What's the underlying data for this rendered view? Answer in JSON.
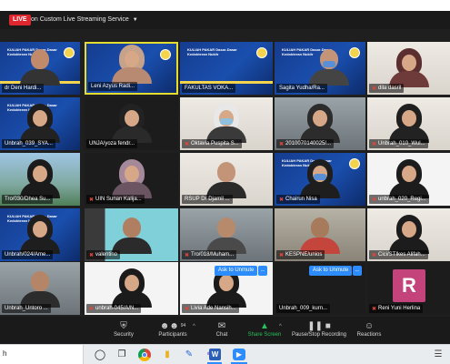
{
  "topbar": {
    "live_label": "LIVE",
    "stream_label": "on Custom Live Streaming Service"
  },
  "slide": {
    "title": "KULIAH PAKAR Dasar-Dasar Kedokteran Nuklir",
    "date": "Sabtu, 27 Maret 2021"
  },
  "participants": [
    {
      "name": "dr Deni Hardi...",
      "muted": false
    },
    {
      "name": "Leni Azyus Radi...",
      "muted": false
    },
    {
      "name": "FAKULTAS VOKA...",
      "muted": false
    },
    {
      "name": "Sagita Yudha/Ra...",
      "muted": false
    },
    {
      "name": "dila dasril",
      "muted": true
    },
    {
      "name": "Unbrah_039_SYA...",
      "muted": false
    },
    {
      "name": "UNJA/yoza fendr...",
      "muted": false
    },
    {
      "name": "Oktavia Puspita S...",
      "muted": true
    },
    {
      "name": "2010070140025/...",
      "muted": true
    },
    {
      "name": "Unbrah_010_Wul...",
      "muted": true
    },
    {
      "name": "Tro/030/Dhea Su...",
      "muted": false
    },
    {
      "name": "UIN Sunan Kalija...",
      "muted": true
    },
    {
      "name": "RSUP Dr Djamil ...",
      "muted": false
    },
    {
      "name": "Chairun Nisa",
      "muted": true
    },
    {
      "name": "unbrah_020_Regi...",
      "muted": true
    },
    {
      "name": "Unbrah/024/Ame...",
      "muted": false
    },
    {
      "name": "valentino",
      "muted": true
    },
    {
      "name": "Tro/018/Muham...",
      "muted": true
    },
    {
      "name": "KESPNE/unios",
      "muted": true
    },
    {
      "name": "Cici/STIkes Alifah...",
      "muted": true
    },
    {
      "name": "Unbrah_Untoro ...",
      "muted": false
    },
    {
      "name": "unbrah-045/A/N...",
      "muted": true
    },
    {
      "name": "Livia Ade Nansih...",
      "muted": true
    },
    {
      "name": "Unbrah_009_kurn...",
      "muted": false
    },
    {
      "name": "Reni Yuni Herlina",
      "muted": true
    }
  ],
  "avatar_letter": "R",
  "unmute": {
    "label": "Ask to Unmute",
    "more": "..."
  },
  "toolbar": {
    "security": "Security",
    "participants": "Participants",
    "participants_count": "94",
    "chat": "Chat",
    "share": "Share Screen",
    "record": "Pause/Stop Recording",
    "reactions": "Reactions"
  },
  "taskbar": {
    "search_text": "h",
    "word_letter": "W"
  },
  "icons": {
    "security": "shield-icon",
    "participants": "people-icon",
    "chat": "chat-bubble-icon",
    "share": "share-screen-icon",
    "record": "pause-stop-icon",
    "reactions": "smiley-icon"
  },
  "colors": {
    "live_red": "#e0262f",
    "active_speaker": "#e4dc2f",
    "share_green": "#27c05a",
    "zoom_blue": "#2d8cff",
    "muted_red": "#e3453a"
  }
}
